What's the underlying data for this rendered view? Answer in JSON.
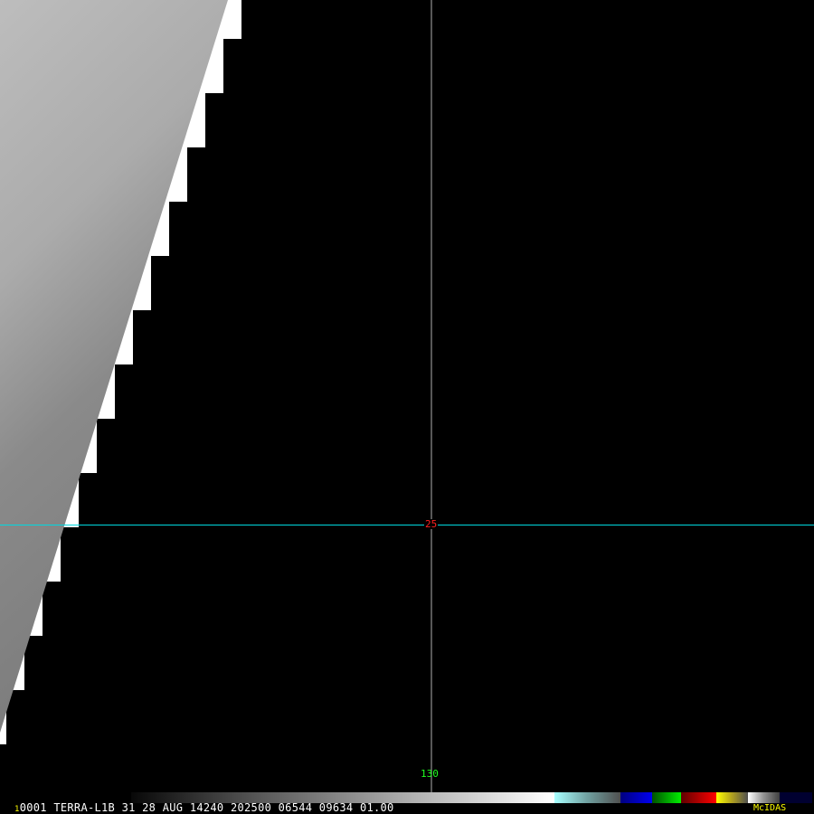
{
  "image": {
    "frame_number": "1",
    "caption": "0001 TERRA-L1B 31 28 AUG 14240 202500 06544 09634 01.00",
    "brand": "McIDAS",
    "latitude_label": "25",
    "longitude_label": "130",
    "colors": {
      "latitude_line": "#00d8e0",
      "longitude_line": "#b0b0b0",
      "latitude_label": "#ff2020",
      "longitude_label": "#20ff20"
    }
  }
}
